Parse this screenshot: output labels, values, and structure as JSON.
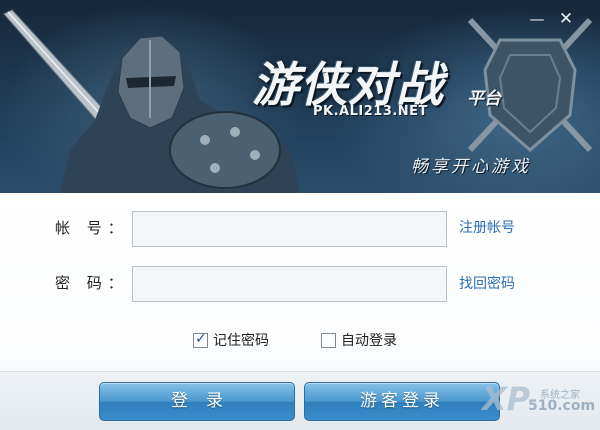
{
  "window": {
    "minimize_icon": "minimize-icon",
    "close_icon": "close-icon",
    "minimize_glyph": "—",
    "close_glyph": "✕"
  },
  "banner": {
    "title": "游侠对战",
    "title_suffix": "平台",
    "url": "PK.ALI213.NET",
    "slogan": "畅享开心游戏"
  },
  "form": {
    "account_label": "帐 号：",
    "account_value": "",
    "password_label": "密 码：",
    "password_value": "",
    "register_link": "注册帐号",
    "recover_link": "找回密码",
    "remember_label": "记住密码",
    "remember_checked": true,
    "remember_mark": "✓",
    "autologin_label": "自动登录",
    "autologin_checked": false
  },
  "buttons": {
    "login": "登录",
    "guest_login": "游客登录"
  },
  "watermark": {
    "logo": "XP",
    "name": "系统之家",
    "site": "510.com"
  },
  "colors": {
    "banner_dark": "#16283a",
    "link": "#2b6fb6",
    "button": "#4a97cd",
    "input_bg": "#f5f6f7"
  }
}
